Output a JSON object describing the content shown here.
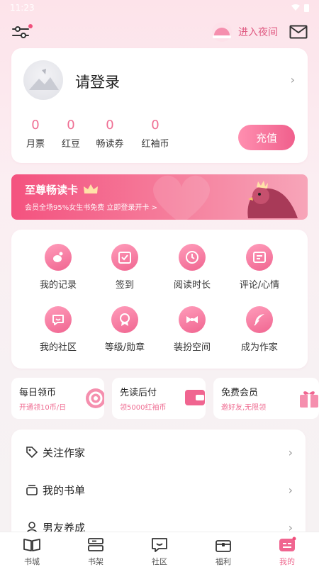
{
  "status_bar": {
    "time": "11:23"
  },
  "header": {
    "night_mode_label": "进入夜间"
  },
  "profile": {
    "login_text": "请登录",
    "stats": [
      {
        "value": "0",
        "label": "月票"
      },
      {
        "value": "0",
        "label": "红豆"
      },
      {
        "value": "0",
        "label": "畅读券"
      },
      {
        "value": "0",
        "label": "红袖币"
      }
    ],
    "recharge_label": "充值"
  },
  "vip_banner": {
    "title": "至尊畅读卡",
    "subtitle": "会员全场95%女生书免费  立即登录开卡 >"
  },
  "features": [
    {
      "label": "我的记录",
      "icon": "footprint-icon"
    },
    {
      "label": "签到",
      "icon": "checkin-icon"
    },
    {
      "label": "阅读时长",
      "icon": "clock-icon"
    },
    {
      "label": "评论/心情",
      "icon": "comment-book-icon"
    },
    {
      "label": "我的社区",
      "icon": "chat-icon"
    },
    {
      "label": "等级/勋章",
      "icon": "medal-icon"
    },
    {
      "label": "装扮空间",
      "icon": "bowtie-icon"
    },
    {
      "label": "成为作家",
      "icon": "feather-icon"
    }
  ],
  "perks": [
    {
      "title": "每日领币",
      "subtitle": "开通领10币/日",
      "icon": "coin-wheel-icon"
    },
    {
      "title": "先读后付",
      "subtitle": "领5000红袖币",
      "icon": "wallet-icon"
    },
    {
      "title": "免费会员",
      "subtitle": "邀好友,无限领",
      "icon": "gift-icon"
    }
  ],
  "menu": [
    {
      "label": "关注作家",
      "icon": "tag-icon"
    },
    {
      "label": "我的书单",
      "icon": "booklist-icon"
    },
    {
      "label": "男友养成",
      "icon": "person-icon"
    }
  ],
  "tabs": [
    {
      "label": "书城",
      "icon": "open-book-icon"
    },
    {
      "label": "书架",
      "icon": "bookshelf-icon"
    },
    {
      "label": "社区",
      "icon": "community-chat-icon"
    },
    {
      "label": "福利",
      "icon": "treasure-icon"
    },
    {
      "label": "我的",
      "icon": "profile-card-icon",
      "active": true
    }
  ],
  "colors": {
    "accent": "#ef6e93",
    "banner": "#f4527f"
  }
}
